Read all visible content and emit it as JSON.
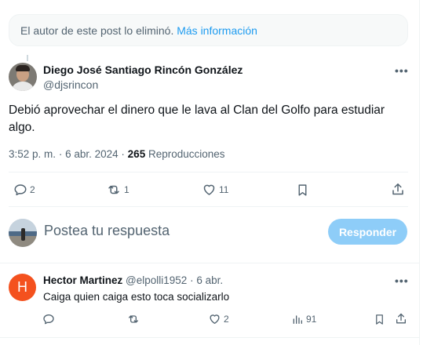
{
  "notice": {
    "text": "El autor de este post lo eliminó.",
    "link": "Más información"
  },
  "tweet": {
    "author_name": "Diego José Santiago Rincón González",
    "author_handle": "@djsrincon",
    "text": "Debió aprovechar el dinero que le lava al Clan del Golfo para estudiar algo.",
    "time": "3:52 p. m.",
    "separator": "·",
    "date": "6 abr. 2024",
    "views_count": "265",
    "views_label": "Reproducciones",
    "actions": {
      "replies": "2",
      "retweets": "1",
      "likes": "11",
      "bookmark_icon": "bookmark-icon",
      "share_icon": "share-icon"
    }
  },
  "compose": {
    "placeholder": "Postea tu respuesta",
    "button_label": "Responder"
  },
  "reply": {
    "avatar_letter": "H",
    "name": "Hector Martinez",
    "handle": "@elpolli1952",
    "separator": "·",
    "date": "6 abr.",
    "text": "Caiga quien caiga esto toca socializarlo",
    "actions": {
      "replies": "",
      "retweets": "",
      "likes": "2",
      "views": "91"
    }
  },
  "colors": {
    "accent": "#1d9bf0",
    "button_disabled": "#8ecdf8",
    "muted_text": "#536471",
    "avatar_h": "#f4511e"
  }
}
